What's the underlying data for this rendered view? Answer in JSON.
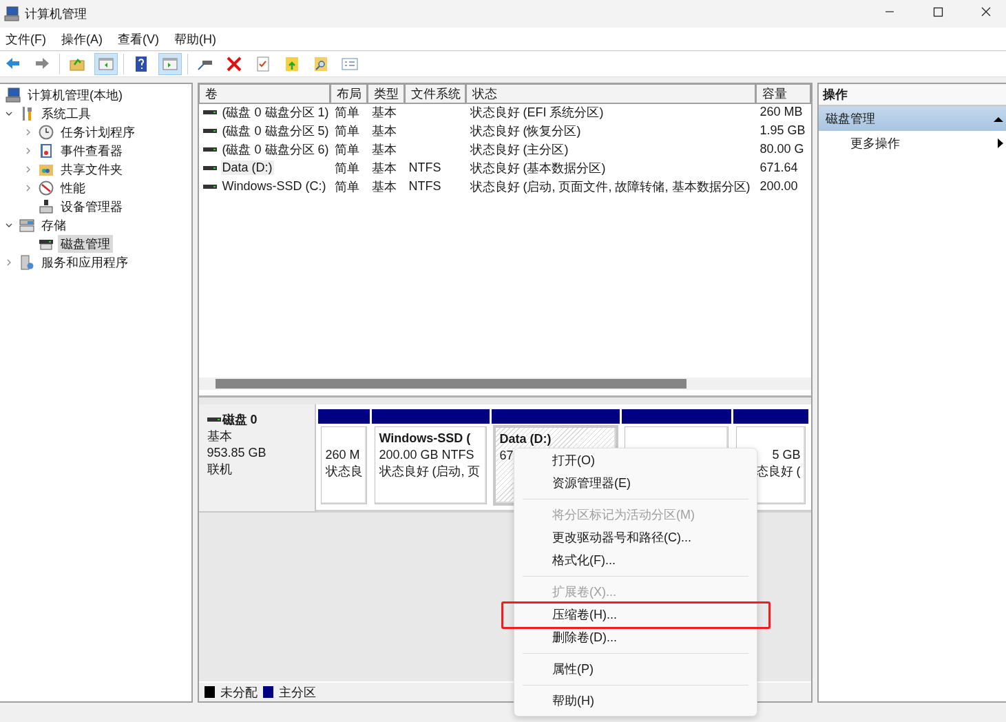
{
  "window": {
    "title": "计算机管理"
  },
  "menu_bar": [
    {
      "label": "文件(F)"
    },
    {
      "label": "操作(A)"
    },
    {
      "label": "查看(V)"
    },
    {
      "label": "帮助(H)"
    }
  ],
  "toolbar": [
    {
      "kind": "back",
      "pressed": false
    },
    {
      "kind": "forward",
      "pressed": false
    },
    {
      "kind": "sep"
    },
    {
      "kind": "up",
      "pressed": false
    },
    {
      "kind": "tree",
      "pressed": true
    },
    {
      "kind": "sep"
    },
    {
      "kind": "help",
      "pressed": false
    },
    {
      "kind": "pane",
      "pressed": true
    },
    {
      "kind": "sep"
    },
    {
      "kind": "connect",
      "pressed": false
    },
    {
      "kind": "delete",
      "pressed": false
    },
    {
      "kind": "check",
      "pressed": false
    },
    {
      "kind": "export",
      "pressed": false
    },
    {
      "kind": "find",
      "pressed": false
    },
    {
      "kind": "list",
      "pressed": false
    }
  ],
  "tree": [
    {
      "label": "计算机管理(本地)",
      "kind": "computer",
      "selected": false,
      "children": [
        {
          "label": "系统工具",
          "kind": "tools",
          "expanded": true,
          "selected": false,
          "children": [
            {
              "label": "任务计划程序",
              "kind": "clock",
              "expanded": false,
              "selected": false
            },
            {
              "label": "事件查看器",
              "kind": "event",
              "expanded": false,
              "selected": false
            },
            {
              "label": "共享文件夹",
              "kind": "share",
              "expanded": false,
              "selected": false
            },
            {
              "label": "性能",
              "kind": "perf",
              "expanded": false,
              "selected": false
            },
            {
              "label": "设备管理器",
              "kind": "device",
              "selected": false
            }
          ]
        },
        {
          "label": "存储",
          "kind": "storage",
          "expanded": true,
          "selected": false,
          "children": [
            {
              "label": "磁盘管理",
              "kind": "disk",
              "selected": true
            }
          ]
        },
        {
          "label": "服务和应用程序",
          "kind": "services",
          "expanded": false,
          "selected": false
        }
      ]
    }
  ],
  "table": {
    "columns": [
      "卷",
      "布局",
      "类型",
      "文件系统",
      "状态",
      "容量"
    ],
    "rows": [
      {
        "selected": false,
        "cells": [
          "(磁盘 0 磁盘分区 1)",
          "简单",
          "基本",
          "",
          "状态良好 (EFI 系统分区)",
          "260 MB"
        ]
      },
      {
        "selected": false,
        "cells": [
          "(磁盘 0 磁盘分区 5)",
          "简单",
          "基本",
          "",
          "状态良好 (恢复分区)",
          "1.95 GB"
        ]
      },
      {
        "selected": false,
        "cells": [
          "(磁盘 0 磁盘分区 6)",
          "简单",
          "基本",
          "",
          "状态良好 (主分区)",
          "80.00 G"
        ]
      },
      {
        "selected": true,
        "cells": [
          "Data (D:)",
          "简单",
          "基本",
          "NTFS",
          "状态良好 (基本数据分区)",
          "671.64"
        ]
      },
      {
        "selected": false,
        "cells": [
          "Windows-SSD (C:)",
          "简单",
          "基本",
          "NTFS",
          "状态良好 (启动, 页面文件, 故障转储, 基本数据分区)",
          "200.00"
        ]
      }
    ]
  },
  "disk": {
    "name": "磁盘 0",
    "type": "基本",
    "size": "953.85 GB",
    "status": "联机",
    "partitions": [
      {
        "selected": false,
        "clipped": false,
        "lines": [
          "260 M",
          "状态良"
        ]
      },
      {
        "selected": false,
        "clipped": false,
        "title": "Windows-SSD  (",
        "lines": [
          "200.00 GB NTFS",
          "状态良好 (启动, 页"
        ]
      },
      {
        "selected": true,
        "clipped": false,
        "title": "Data  (D:)",
        "lines": [
          "67"
        ]
      },
      {
        "selected": false
      },
      {
        "selected": false,
        "clipped": true,
        "lines": [
          "5 GB",
          "态良好 ("
        ]
      }
    ]
  },
  "legend": [
    {
      "label": "未分配",
      "color": "#000000"
    },
    {
      "label": "主分区",
      "color": "#000080"
    }
  ],
  "actions": {
    "title": "操作",
    "section": "磁盘管理",
    "expanded": true,
    "items": [
      "更多操作"
    ]
  },
  "context_menu": [
    {
      "kind": "item",
      "label": "打开(O)",
      "disabled": false,
      "highlighted": false
    },
    {
      "kind": "item",
      "label": "资源管理器(E)",
      "disabled": false,
      "highlighted": false
    },
    {
      "kind": "separator"
    },
    {
      "kind": "item",
      "label": "将分区标记为活动分区(M)",
      "disabled": true,
      "highlighted": false
    },
    {
      "kind": "item",
      "label": "更改驱动器号和路径(C)...",
      "disabled": false,
      "highlighted": false
    },
    {
      "kind": "item",
      "label": "格式化(F)...",
      "disabled": false,
      "highlighted": false
    },
    {
      "kind": "separator"
    },
    {
      "kind": "item",
      "label": "扩展卷(X)...",
      "disabled": true,
      "highlighted": false
    },
    {
      "kind": "item",
      "label": "压缩卷(H)...",
      "disabled": false,
      "highlighted": true
    },
    {
      "kind": "item",
      "label": "删除卷(D)...",
      "disabled": false,
      "highlighted": false
    },
    {
      "kind": "separator"
    },
    {
      "kind": "item",
      "label": "属性(P)",
      "disabled": false,
      "highlighted": false
    },
    {
      "kind": "separator"
    },
    {
      "kind": "item",
      "label": "帮助(H)",
      "disabled": false,
      "highlighted": false
    }
  ]
}
